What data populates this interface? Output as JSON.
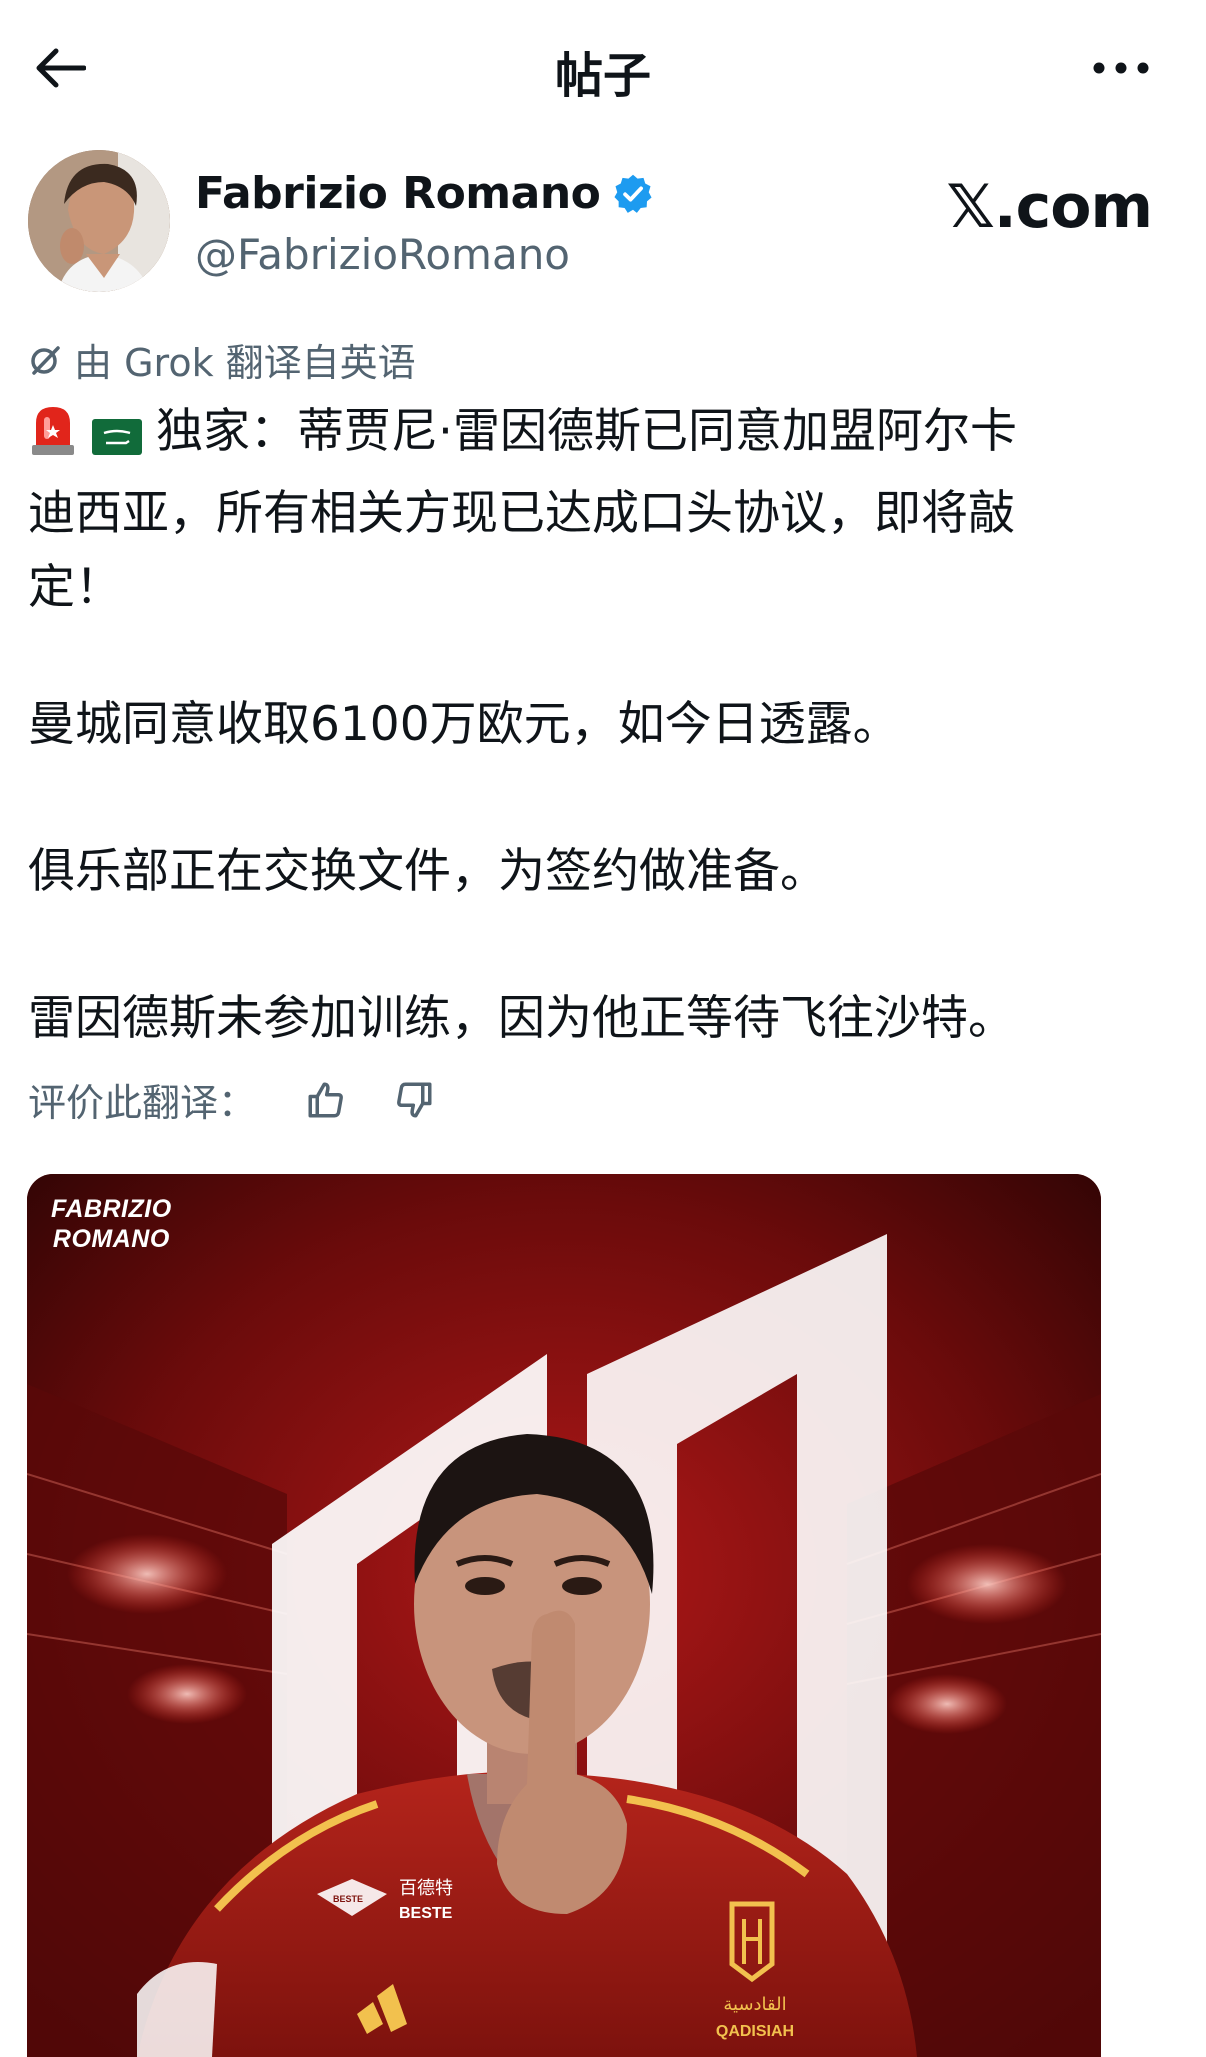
{
  "header": {
    "title": "帖子"
  },
  "author": {
    "name": "Fabrizio Romano",
    "handle": "@FabrizioRomano",
    "verified_color": "#1d9bf0"
  },
  "brand": "𝕏.com",
  "translation": {
    "notice": "由 Grok 翻译自英语",
    "rate_label": "评价此翻译："
  },
  "post": {
    "line1": "独家：蒂贾尼·雷因德斯已同意加盟阿尔卡",
    "line2": "迪西亚，所有相关方现已达成口头协议，即将敲",
    "line3": "定！",
    "para2": "曼城同意收取6100万欧元，如今日透露。",
    "para3": "俱乐部正在交换文件，为签约做准备。",
    "para4": "雷因德斯未参加训练，因为他正等待飞往沙特。"
  },
  "media": {
    "watermark_line1": "FABRIZIO",
    "watermark_line2": "ROMANO",
    "sponsor_cn": "百德特",
    "sponsor_en": "BESTE",
    "badge_small": "BESTE",
    "club_arabic": "القادسية",
    "club_latin": "QADISIAH"
  },
  "icons": {
    "back": "arrow-left-icon",
    "more": "more-dots-icon",
    "verified": "verified-badge-icon",
    "translate": "grok-icon",
    "siren": "siren-emoji-icon",
    "flag": "saudi-flag-emoji-icon",
    "like": "thumbs-up-icon",
    "dislike": "thumbs-down-icon"
  }
}
